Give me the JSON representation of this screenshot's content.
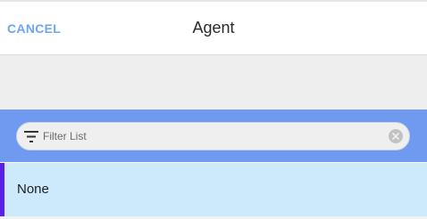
{
  "header": {
    "cancel_label": "CANCEL",
    "title": "Agent"
  },
  "filter": {
    "placeholder": "Filter List",
    "value": "",
    "icon": "filter-icon",
    "clear_icon": "clear-icon"
  },
  "list": {
    "items": [
      {
        "label": "None",
        "selected": true
      }
    ]
  },
  "colors": {
    "accent": "#6aa7f0",
    "filter_bar": "#709af0",
    "selected_row": "#cdeafd",
    "selection_indicator": "#5a1fea"
  }
}
